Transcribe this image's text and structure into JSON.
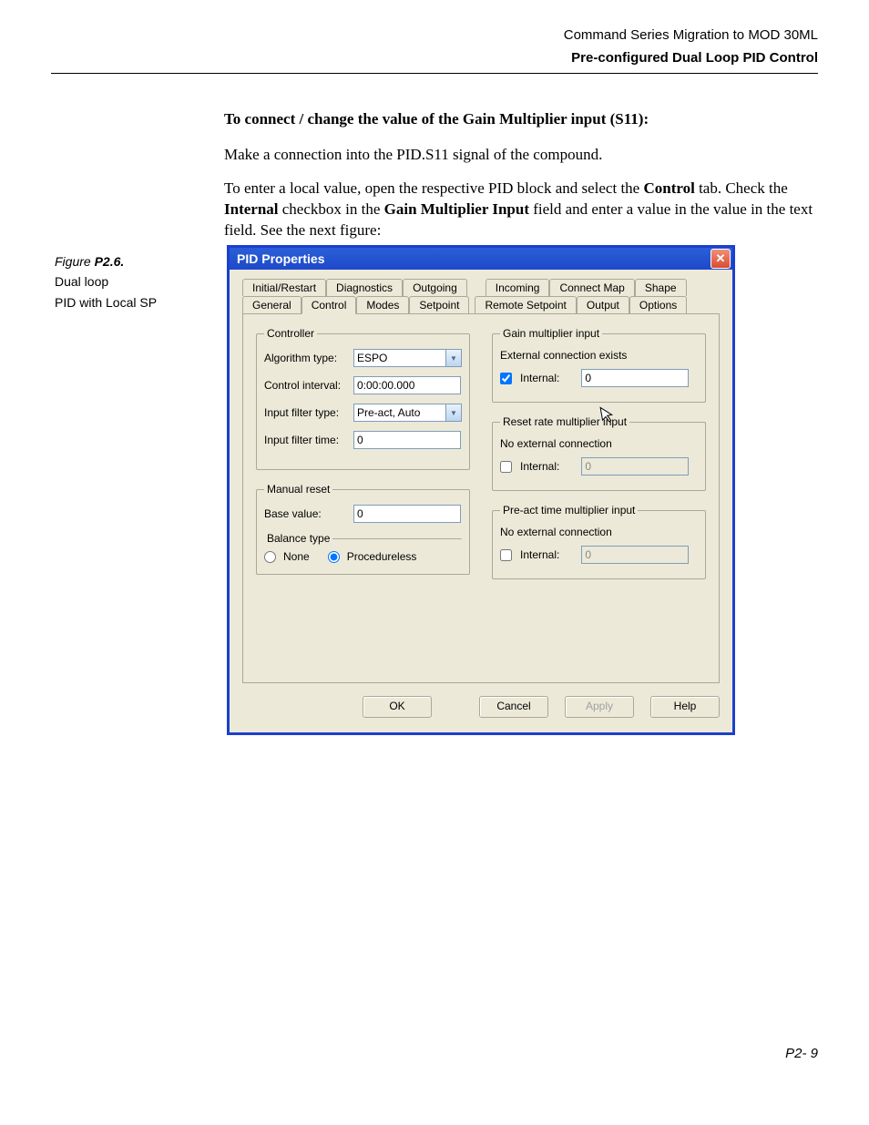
{
  "header": {
    "line1": "Command Series Migration to MOD 30ML",
    "line2": "Pre-configured Dual Loop PID Control"
  },
  "body": {
    "heading": "To connect / change the value of the Gain Multiplier input (S11):",
    "para1": "Make a connection into the PID.S11 signal of the compound.",
    "para2_pre": "To enter a local value, open the respective PID block and select the ",
    "para2_b1": "Control",
    "para2_mid1": " tab. Check the ",
    "para2_b2": "Internal",
    "para2_mid2": " checkbox in the ",
    "para2_b3": "Gain Multiplier Input",
    "para2_post": " field and enter a value in the value in the text field. See the next figure:"
  },
  "caption": {
    "label": "Figure ",
    "num": "P2.6.",
    "line1": "Dual loop",
    "line2": "PID with Local SP"
  },
  "dialog": {
    "title": "PID Properties",
    "tabs_row1": [
      "Initial/Restart",
      "Diagnostics",
      "Outgoing",
      "Incoming",
      "Connect Map",
      "Shape"
    ],
    "tabs_row2": [
      "General",
      "Control",
      "Modes",
      "Setpoint",
      "Remote Setpoint",
      "Output",
      "Options"
    ],
    "active_tab": "Control",
    "controller": {
      "legend": "Controller",
      "algorithm_label": "Algorithm type:",
      "algorithm_value": "ESPO",
      "interval_label": "Control interval:",
      "interval_value": "0:00:00.000",
      "filter_type_label": "Input filter type:",
      "filter_type_value": "Pre-act, Auto",
      "filter_time_label": "Input filter time:",
      "filter_time_value": "0"
    },
    "manual_reset": {
      "legend": "Manual reset",
      "base_label": "Base value:",
      "base_value": "0",
      "balance_legend": "Balance type",
      "radio_none": "None",
      "radio_proc": "Procedureless"
    },
    "gain": {
      "legend": "Gain multiplier input",
      "status": "External connection exists",
      "cb_label": "Internal:",
      "value": "0",
      "checked": true
    },
    "reset": {
      "legend": "Reset rate multiplier input",
      "status": "No external connection",
      "cb_label": "Internal:",
      "value": "0",
      "checked": false
    },
    "preact": {
      "legend": "Pre-act time multiplier input",
      "status": "No external connection",
      "cb_label": "Internal:",
      "value": "0",
      "checked": false
    },
    "buttons": {
      "ok": "OK",
      "cancel": "Cancel",
      "apply": "Apply",
      "help": "Help"
    }
  },
  "page_number": "P2- 9"
}
